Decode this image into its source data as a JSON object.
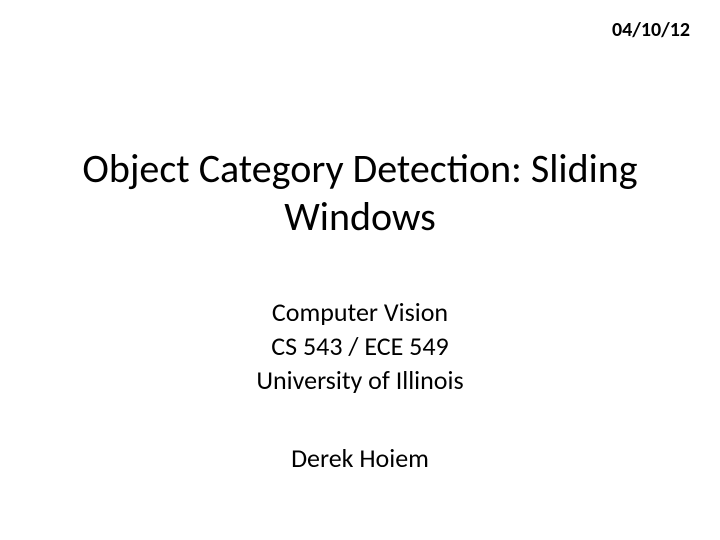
{
  "date": "04/10/12",
  "title": "Object Category Detection: Sliding Windows",
  "subtitle": {
    "line1": "Computer Vision",
    "line2": "CS 543 / ECE 549",
    "line3": "University of Illinois"
  },
  "author": "Derek Hoiem"
}
